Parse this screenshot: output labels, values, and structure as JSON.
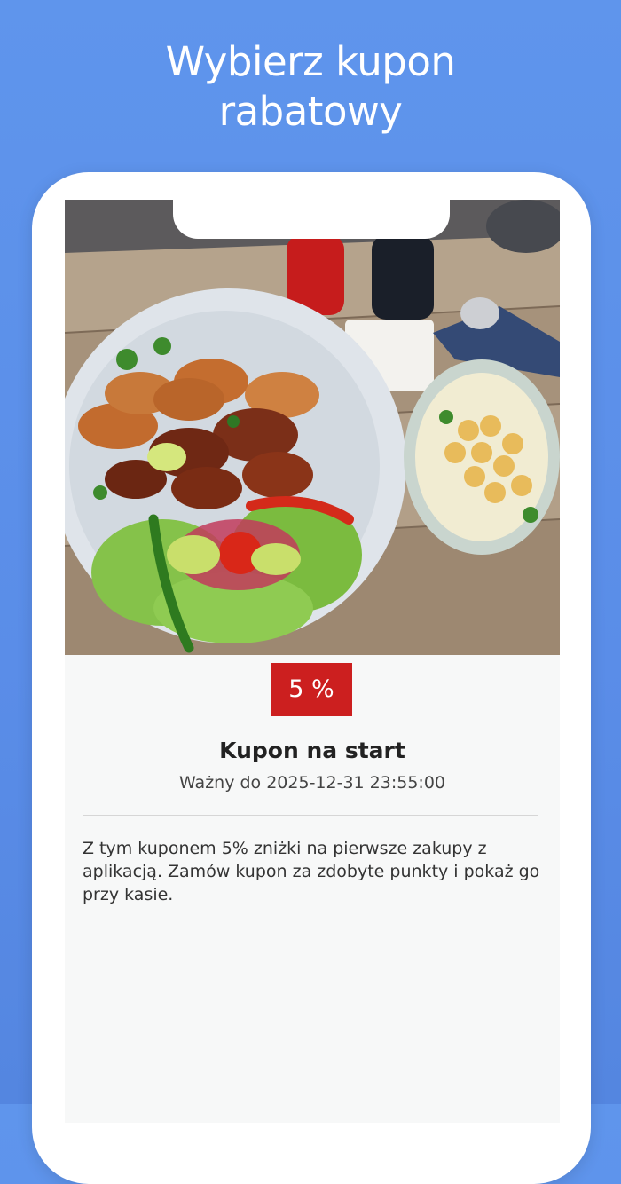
{
  "headline": {
    "line1": "Wybierz kupon",
    "line2": "rabatowy"
  },
  "coupon": {
    "image_name": "food-photo",
    "discount": "5 %",
    "title": "Kupon na start",
    "validity": "Ważny do 2025-12-31 23:55:00",
    "description": "Z tym kuponem 5% zniżki na pierwsze zakupy z aplikacją. Zamów kupon za zdobyte punkty i pokaż go przy kasie."
  },
  "colors": {
    "background": "#5a8de8",
    "badge": "#cc1f1f",
    "phone_frame": "#ffffff",
    "screen": "#f7f8f8"
  }
}
